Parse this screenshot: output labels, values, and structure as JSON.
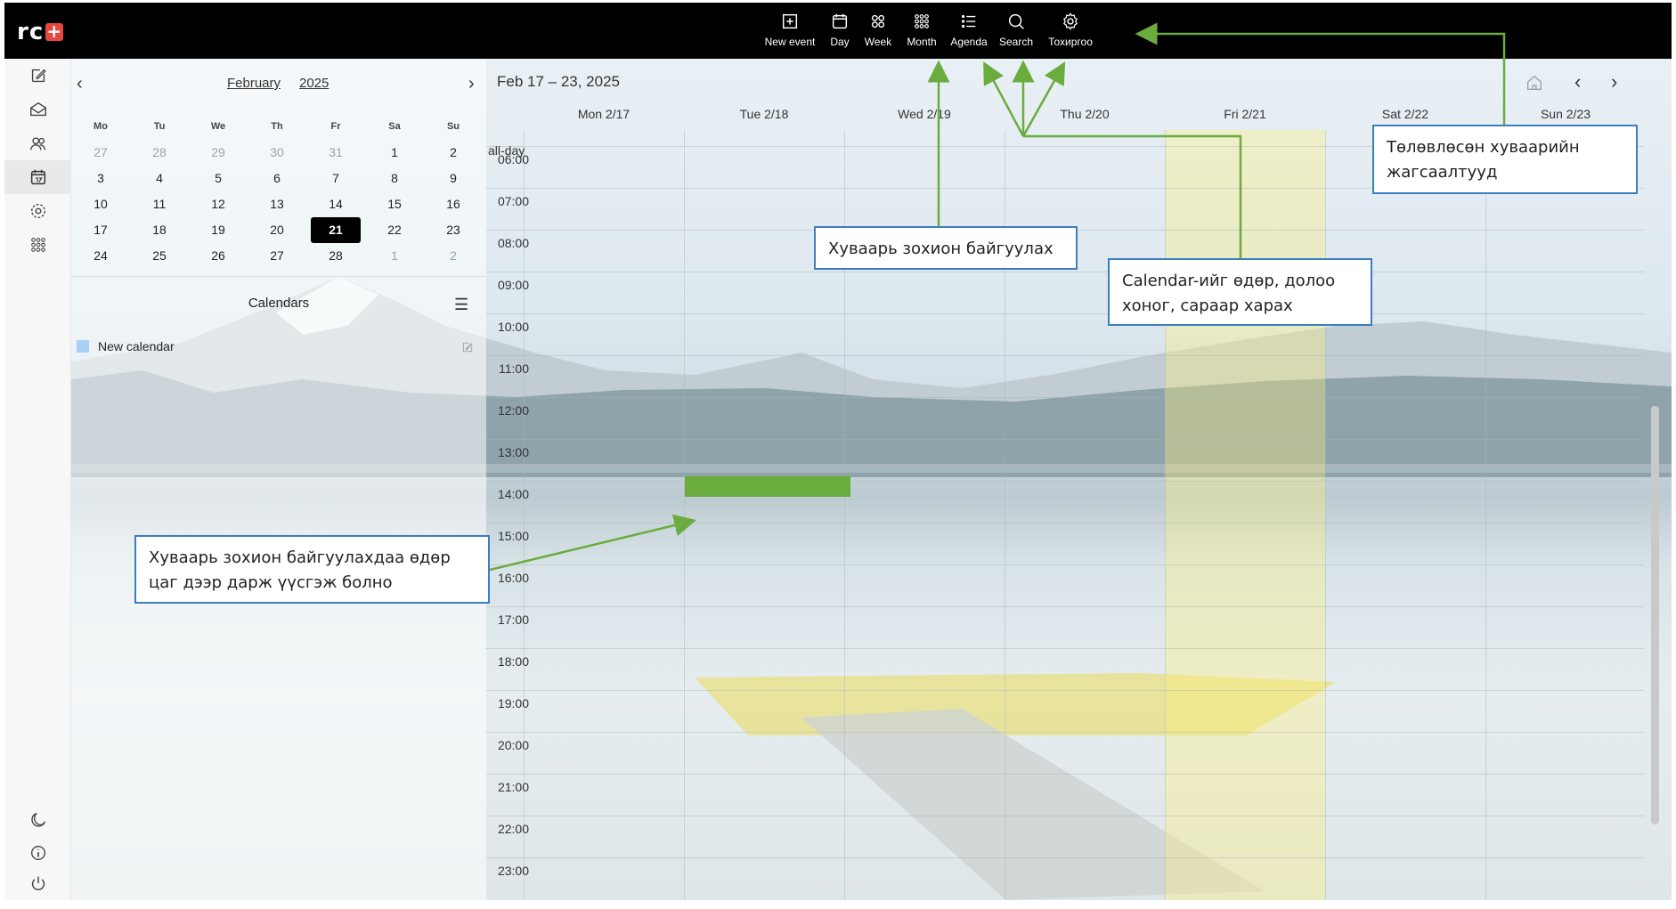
{
  "app": {
    "logo_text": "rc",
    "logo_plus": "+"
  },
  "toolbar": {
    "items": [
      {
        "label": "New event",
        "icon": "plus-square-icon"
      },
      {
        "label": "Day",
        "icon": "calendar-day-icon"
      },
      {
        "label": "Week",
        "icon": "grid-four-icon"
      },
      {
        "label": "Month",
        "icon": "grid-nine-icon"
      },
      {
        "label": "Agenda",
        "icon": "list-icon"
      },
      {
        "label": "Search",
        "icon": "search-icon"
      },
      {
        "label": "Тохиргоо",
        "icon": "gear-icon"
      }
    ]
  },
  "rail": {
    "top_icons": [
      "compose-icon",
      "mail-icon",
      "contacts-icon",
      "calendar-icon",
      "settings-icon",
      "apps-icon"
    ],
    "bottom_icons": [
      "moon-icon",
      "info-icon",
      "power-icon"
    ]
  },
  "mini_calendar": {
    "month": "February",
    "year": "2025",
    "prev": "‹",
    "next": "›",
    "weekdays": [
      "Mo",
      "Tu",
      "We",
      "Th",
      "Fr",
      "Sa",
      "Su"
    ],
    "weeks": [
      [
        "27",
        "28",
        "29",
        "30",
        "31",
        "1",
        "2"
      ],
      [
        "3",
        "4",
        "5",
        "6",
        "7",
        "8",
        "9"
      ],
      [
        "10",
        "11",
        "12",
        "13",
        "14",
        "15",
        "16"
      ],
      [
        "17",
        "18",
        "19",
        "20",
        "21",
        "22",
        "23"
      ],
      [
        "24",
        "25",
        "26",
        "27",
        "28",
        "1",
        "2"
      ]
    ],
    "today": "21"
  },
  "calendars": {
    "title": "Calendars",
    "items": [
      {
        "name": "New calendar",
        "color": "#a9d1f5"
      }
    ]
  },
  "week_view": {
    "range": "Feb 17 – 23, 2025",
    "days": [
      "Mon 2/17",
      "Tue 2/18",
      "Wed 2/19",
      "Thu 2/20",
      "Fri 2/21",
      "Sat 2/22",
      "Sun 2/23"
    ],
    "allday_label": "all-day",
    "times": [
      "06:00",
      "07:00",
      "08:00",
      "09:00",
      "10:00",
      "11:00",
      "12:00",
      "13:00",
      "14:00",
      "15:00",
      "16:00",
      "17:00",
      "18:00",
      "19:00",
      "20:00",
      "21:00",
      "22:00",
      "23:00"
    ],
    "today_day": "Fri 2/21",
    "selected_slot": {
      "day": "Tue 2/18",
      "start": "14:00",
      "end": "14:30"
    }
  },
  "callouts": {
    "new_event": "Хуваарь зохион байгуулах",
    "views_line1": "Calendar-ийг өдөр, долоо",
    "views_line2": "хоног, сараар харах",
    "agenda_line1": "Төлөвлөсөн хуваарийн",
    "agenda_line2": "жагсаалтууд",
    "create_line1": "Хуваарь зохион байгуулахдаа өдөр",
    "create_line2": "цаг дээр дарж үүсгэж болно"
  },
  "colors": {
    "accent_green": "#6aac3d",
    "callout_border": "#3b7fbf",
    "today_highlight": "#fff078",
    "logo_plus": "#e8453c"
  }
}
